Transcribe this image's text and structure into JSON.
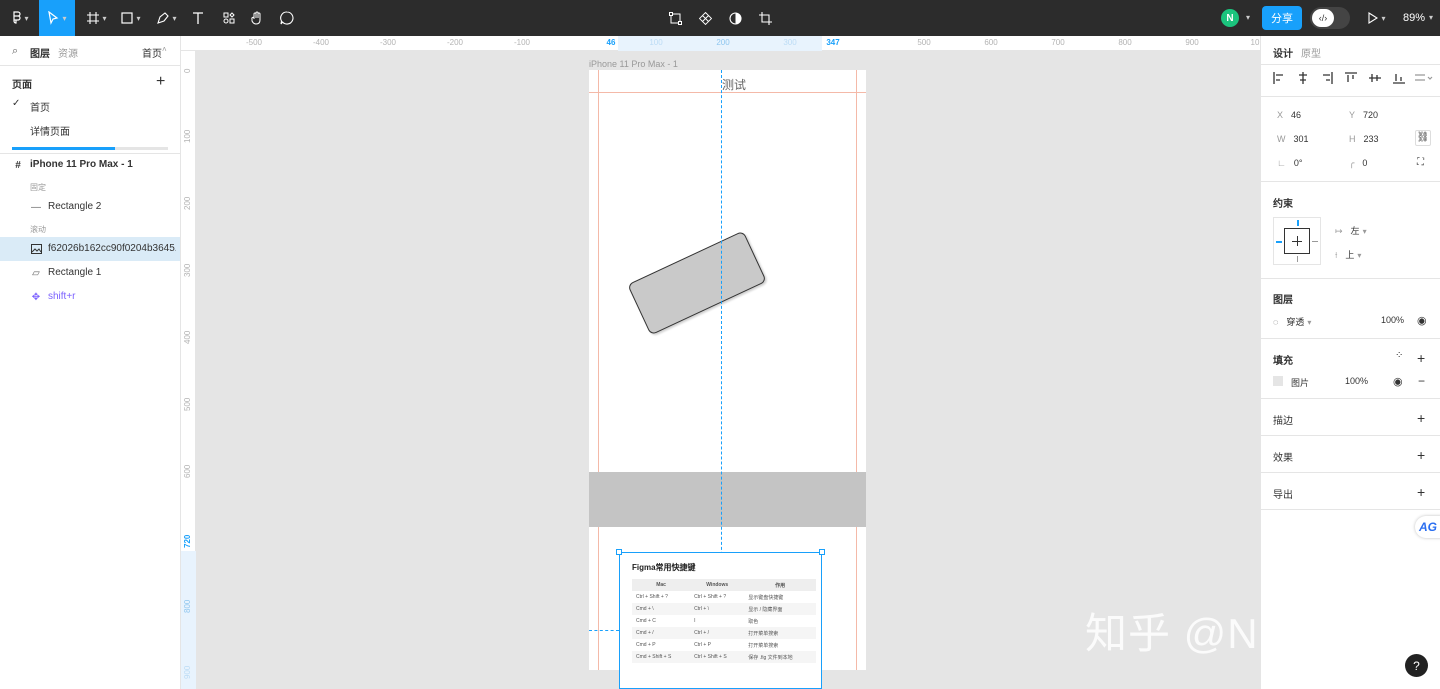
{
  "toolbar": {
    "zoom": "89%",
    "share_label": "分享",
    "avatar_initial": "N",
    "accent": "#18a0fb"
  },
  "left_panel": {
    "tabs": {
      "layers": "图层",
      "assets": "资源",
      "page_select": "首页"
    },
    "pages_heading": "页面",
    "pages": [
      {
        "label": "首页",
        "current": true
      },
      {
        "label": "详情页面",
        "current": false
      }
    ],
    "layers": {
      "frame": "iPhone 11 Pro Max - 1",
      "fixed_section": "固定",
      "scroll_section": "滚动",
      "items": [
        {
          "label": "Rectangle 2",
          "icon": "line-icon"
        },
        {
          "label": "f62026b162cc90f0204b3645...",
          "icon": "image-icon"
        },
        {
          "label": "Rectangle 1",
          "icon": "rectangle-icon"
        },
        {
          "label": "shift+r",
          "icon": "component-icon"
        }
      ]
    }
  },
  "rulers": {
    "top": [
      "-500",
      "-400",
      "-300",
      "-200",
      "-100",
      "46",
      "100",
      "200",
      "300",
      "347",
      "500",
      "600",
      "700",
      "800",
      "900",
      "10"
    ],
    "left": [
      "0",
      "100",
      "200",
      "300",
      "400",
      "500",
      "600",
      "720",
      "800",
      "900"
    ]
  },
  "canvas": {
    "frame_label": "iPhone 11 Pro Max - 1",
    "frame_title": "测试",
    "image_title": "Figma常用快捷键",
    "table_headers": [
      "Mac",
      "Windows",
      "作用"
    ],
    "table_rows": [
      [
        "Ctrl + Shift + ?",
        "Ctrl + Shift + ?",
        "显示键盘快捷键"
      ],
      [
        "Cmd + \\",
        "Ctrl + \\",
        "显示 / 隐藏界面"
      ],
      [
        "Cmd + C",
        "I",
        "取色"
      ],
      [
        "Cmd + /",
        "Ctrl + /",
        "打开菜单搜索"
      ],
      [
        "Cmd + P",
        "Ctrl + P",
        "打开菜单搜索"
      ],
      [
        "Cmd + Shift + S",
        "Ctrl + Shift + S",
        "保存 .fig 文件到本地"
      ]
    ],
    "watermark": "知乎 @NancyED"
  },
  "right_panel": {
    "tabs": {
      "design": "设计",
      "prototype": "原型"
    },
    "x": "46",
    "y": "720",
    "w": "301",
    "h": "233",
    "rotation": "0°",
    "radius": "0",
    "constraints_heading": "约束",
    "h_constraint": "左",
    "v_constraint": "上",
    "layer_heading": "图层",
    "blend_mode": "穿透",
    "layer_opacity": "100%",
    "fill_heading": "填充",
    "fill_type": "图片",
    "fill_opacity": "100%",
    "stroke_heading": "描边",
    "effects_heading": "效果",
    "export_heading": "导出",
    "badge": "AG"
  },
  "help_label": "?"
}
